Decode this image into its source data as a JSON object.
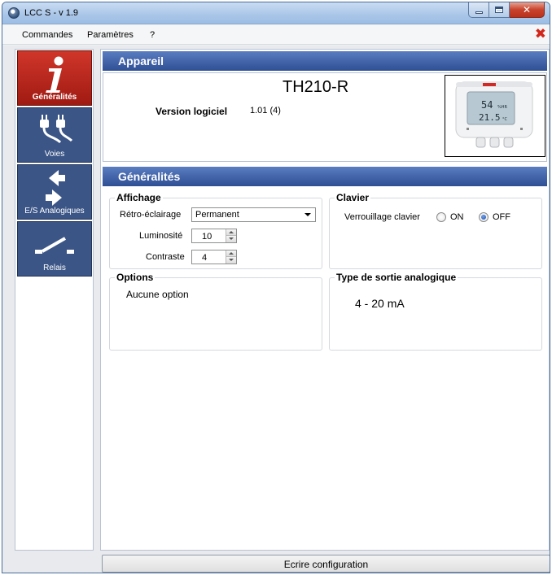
{
  "window": {
    "title": "LCC S - v 1.9"
  },
  "menu": {
    "items": [
      "Commandes",
      "Paramètres",
      "?"
    ]
  },
  "sidebar": {
    "items": [
      {
        "label": "Généralités",
        "icon": "info-icon",
        "active": true
      },
      {
        "label": "Voies",
        "icon": "plugs-icon",
        "active": false
      },
      {
        "label": "E/S Analogiques",
        "icon": "arrows-icon",
        "active": false
      },
      {
        "label": "Relais",
        "icon": "relay-switch-icon",
        "active": false
      }
    ]
  },
  "appareil": {
    "header": "Appareil",
    "model": "TH210-R",
    "version_label": "Version logiciel",
    "version_value": "1.01 (4)",
    "device_display": {
      "line1": "54",
      "line1_unit": "%HR",
      "line2": "21.5",
      "line2_unit": "°C"
    }
  },
  "generalites": {
    "header": "Généralités",
    "affichage": {
      "title": "Affichage",
      "retro_label": "Rétro-éclairage",
      "retro_value": "Permanent",
      "luminosite_label": "Luminosité",
      "luminosite_value": "10",
      "contraste_label": "Contraste",
      "contraste_value": "4"
    },
    "clavier": {
      "title": "Clavier",
      "lock_label": "Verrouillage clavier",
      "on_label": "ON",
      "off_label": "OFF",
      "selected": "OFF"
    },
    "options": {
      "title": "Options",
      "text": "Aucune option"
    },
    "sortie": {
      "title": "Type de sortie analogique",
      "value": "4 - 20 mA"
    }
  },
  "footer": {
    "write_button": "Ecrire configuration"
  },
  "colors": {
    "header_blue": "#2f4f95",
    "nav_blue": "#3b5586",
    "nav_active_red": "#c1281e",
    "close_red": "#d2271a"
  }
}
